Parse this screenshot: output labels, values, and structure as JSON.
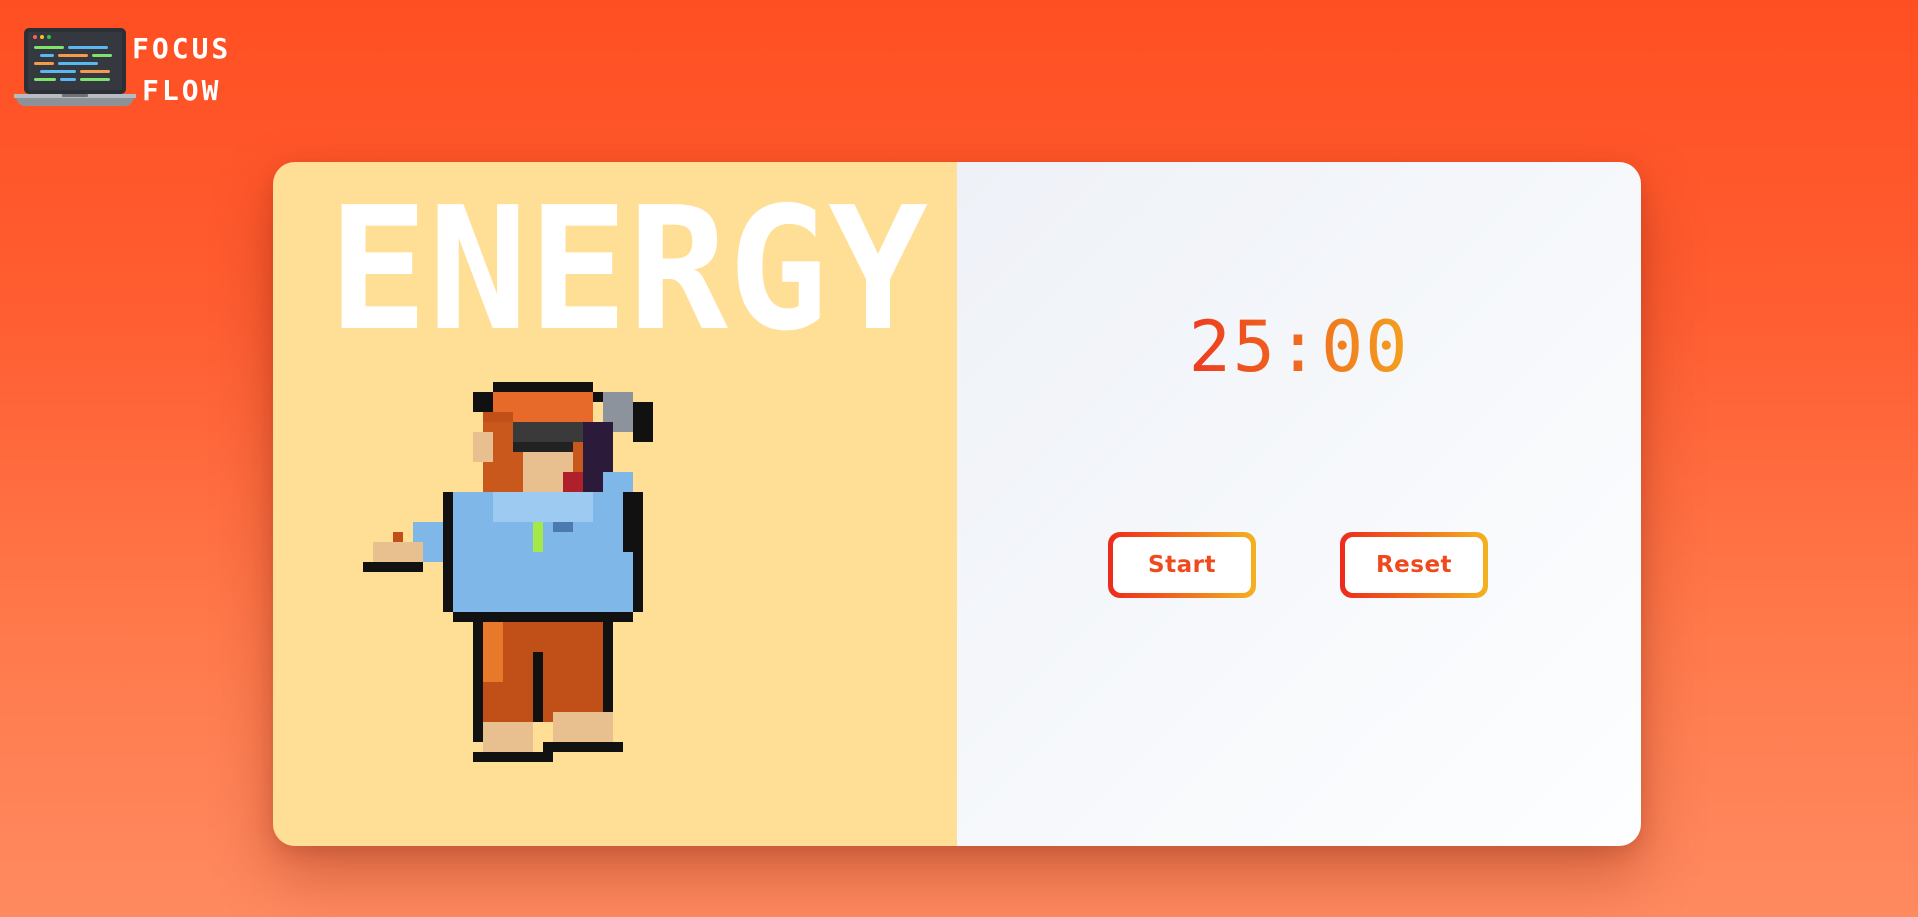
{
  "app": {
    "logo_line1": "FOCUS",
    "logo_line2": "FLOW",
    "logo_icon": "laptop-code-icon"
  },
  "mode": {
    "title": "ENERGY",
    "illustration": "pixel-dancing-monkey"
  },
  "timer": {
    "display": "25:00"
  },
  "controls": {
    "start_label": "Start",
    "reset_label": "Reset"
  },
  "colors": {
    "background": "#ff5a2c",
    "left_panel": "#ffdf96",
    "right_panel": "#f4f6fa",
    "accent_start": "#ee2a1c",
    "accent_end": "#f4b21f"
  }
}
